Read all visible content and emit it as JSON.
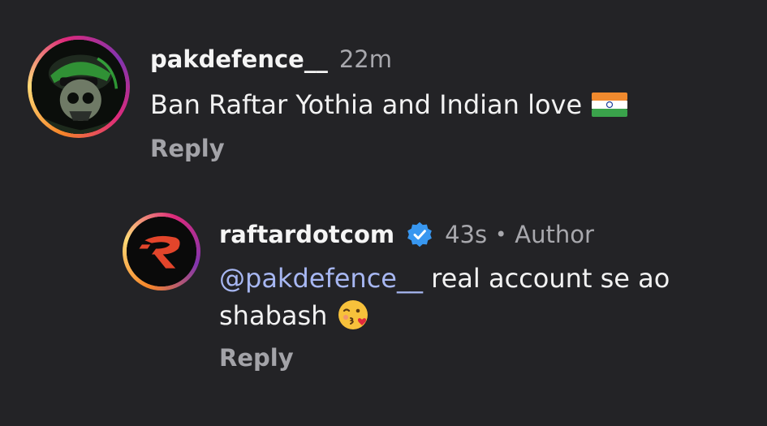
{
  "comments": [
    {
      "username": "pakdefence__",
      "time": "22m",
      "text": "Ban Raftar Yothia and Indian love",
      "emoji_icon": "india-flag-icon",
      "reply_label": "Reply"
    },
    {
      "username": "raftardotcom",
      "verified_icon": "verified-badge-icon",
      "time": "43s",
      "separator": "•",
      "author_label": "Author",
      "mention": "@pakdefence__",
      "text_line1": " real account se ao",
      "text_line2": "shabash",
      "emoji_icon": "kissing-face-icon",
      "reply_label": "Reply"
    }
  ],
  "colors": {
    "background": "#232326",
    "mention": "#a7b7f2",
    "secondary_text": "#a8a8ad",
    "verified_blue": "#3897f0"
  }
}
